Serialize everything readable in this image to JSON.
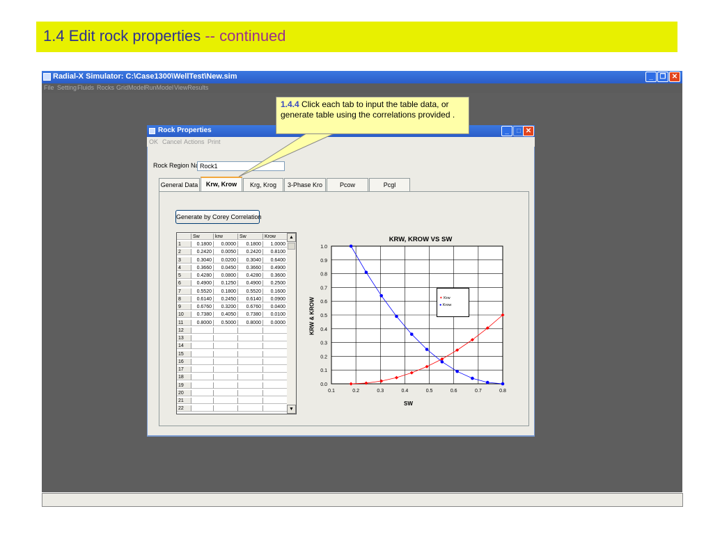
{
  "slide": {
    "title": "1.4 Edit rock properties ",
    "title_suffix": "-- continued"
  },
  "app": {
    "title": "Radial-X Simulator:  C:\\Case1300\\WellTest\\New.sim",
    "menu": [
      "File",
      "Setting",
      "Fluids",
      "Rocks",
      "GridModel",
      "RunModel",
      "ViewResults"
    ]
  },
  "dialog": {
    "title": "Rock Properties",
    "menu": [
      "OK",
      "Cancel",
      "Actions",
      "Print"
    ],
    "region_label": "Rock Region Name",
    "region_value": "Rock1",
    "tabs": [
      "General Data",
      "Krw, Krow",
      "Krg, Krog",
      "3-Phase Kro",
      "Pcow",
      "Pcgl"
    ],
    "active_tab": "Krw, Krow",
    "generate_button": "Generate by Corey Correlation",
    "table": {
      "headers": [
        "",
        "Sw",
        "krw",
        "Sw",
        "Krow"
      ],
      "rows": [
        [
          "1",
          "0.1800",
          "0.0000",
          "0.1800",
          "1.0000"
        ],
        [
          "2",
          "0.2420",
          "0.0050",
          "0.2420",
          "0.8100"
        ],
        [
          "3",
          "0.3040",
          "0.0200",
          "0.3040",
          "0.6400"
        ],
        [
          "4",
          "0.3660",
          "0.0450",
          "0.3660",
          "0.4900"
        ],
        [
          "5",
          "0.4280",
          "0.0800",
          "0.4280",
          "0.3600"
        ],
        [
          "6",
          "0.4900",
          "0.1250",
          "0.4900",
          "0.2500"
        ],
        [
          "7",
          "0.5520",
          "0.1800",
          "0.5520",
          "0.1600"
        ],
        [
          "8",
          "0.6140",
          "0.2450",
          "0.6140",
          "0.0900"
        ],
        [
          "9",
          "0.6760",
          "0.3200",
          "0.6760",
          "0.0400"
        ],
        [
          "10",
          "0.7380",
          "0.4050",
          "0.7380",
          "0.0100"
        ],
        [
          "11",
          "0.8000",
          "0.5000",
          "0.8000",
          "0.0000"
        ],
        [
          "12",
          "",
          "",
          "",
          ""
        ],
        [
          "13",
          "",
          "",
          "",
          ""
        ],
        [
          "14",
          "",
          "",
          "",
          ""
        ],
        [
          "15",
          "",
          "",
          "",
          ""
        ],
        [
          "16",
          "",
          "",
          "",
          ""
        ],
        [
          "17",
          "",
          "",
          "",
          ""
        ],
        [
          "18",
          "",
          "",
          "",
          ""
        ],
        [
          "19",
          "",
          "",
          "",
          ""
        ],
        [
          "20",
          "",
          "",
          "",
          ""
        ],
        [
          "21",
          "",
          "",
          "",
          ""
        ],
        [
          "22",
          "",
          "",
          "",
          ""
        ]
      ]
    }
  },
  "callout": {
    "step": "1.4.4",
    "text": " Click each tab to input the table data, or generate table using the correlations provided ."
  },
  "chart_data": {
    "type": "line",
    "title": "KRW, KROW VS SW",
    "xlabel": "SW",
    "ylabel": "KRW & KROW",
    "xlim": [
      0.1,
      0.8
    ],
    "ylim": [
      0.0,
      1.0
    ],
    "xticks": [
      0.1,
      0.2,
      0.3,
      0.4,
      0.5,
      0.6,
      0.7,
      0.8
    ],
    "yticks": [
      0.0,
      0.1,
      0.2,
      0.3,
      0.4,
      0.5,
      0.6,
      0.7,
      0.8,
      0.9,
      1.0
    ],
    "grid": true,
    "legend_position": "right-middle",
    "series": [
      {
        "name": "Krw",
        "color": "#ff0000",
        "marker": "diamond",
        "x": [
          0.18,
          0.242,
          0.304,
          0.366,
          0.428,
          0.49,
          0.552,
          0.614,
          0.676,
          0.738,
          0.8
        ],
        "y": [
          0.0,
          0.005,
          0.02,
          0.045,
          0.08,
          0.125,
          0.18,
          0.245,
          0.32,
          0.405,
          0.5
        ]
      },
      {
        "name": "Krow",
        "color": "#0000ff",
        "marker": "circle",
        "x": [
          0.18,
          0.242,
          0.304,
          0.366,
          0.428,
          0.49,
          0.552,
          0.614,
          0.676,
          0.738,
          0.8
        ],
        "y": [
          1.0,
          0.81,
          0.64,
          0.49,
          0.36,
          0.25,
          0.16,
          0.09,
          0.04,
          0.01,
          0.0
        ]
      }
    ]
  }
}
